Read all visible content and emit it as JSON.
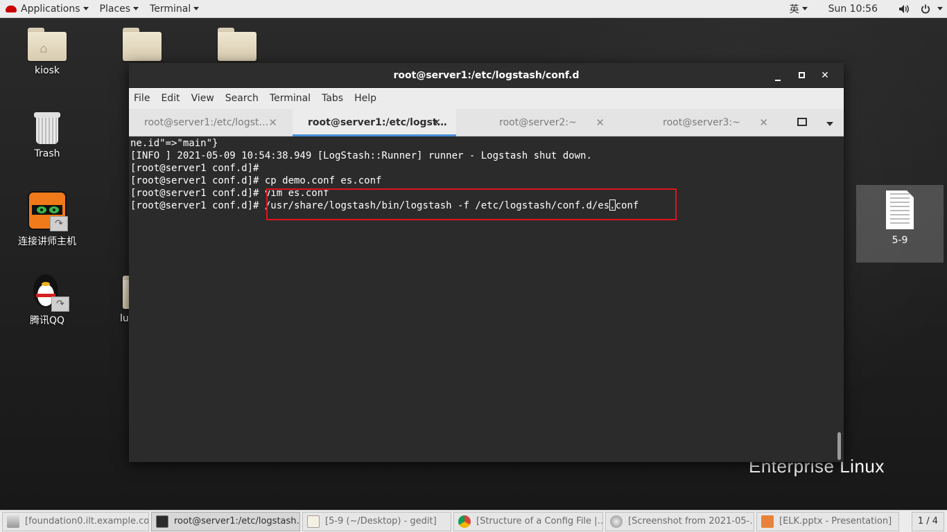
{
  "topbar": {
    "applications": "Applications",
    "places": "Places",
    "terminal": "Terminal",
    "input_method": "英",
    "clock": "Sun 10:56"
  },
  "desktop": {
    "icons": [
      {
        "label": "kiosk",
        "icon": "home-folder-icon"
      },
      {
        "label": "",
        "icon": "folder-icon"
      },
      {
        "label": "",
        "icon": "folder-icon"
      },
      {
        "label": "Trash",
        "icon": "trash-icon"
      },
      {
        "label": "连接讲师主机",
        "icon": "remote-viewer-icon"
      },
      {
        "label": "腾讯QQ",
        "icon": "qq-penguin-icon"
      },
      {
        "label": "lu",
        "icon": "folder-icon"
      }
    ],
    "selected_file": {
      "label": "5-9",
      "icon": "text-document-icon"
    },
    "watermark": "Enterprise Linux"
  },
  "terminal": {
    "title": "root@server1:/etc/logstash/conf.d",
    "menu": [
      "File",
      "Edit",
      "View",
      "Search",
      "Terminal",
      "Tabs",
      "Help"
    ],
    "tabs": [
      {
        "label": "root@server1:/etc/logst…",
        "active": false
      },
      {
        "label": "root@server1:/etc/logst…",
        "active": true
      },
      {
        "label": "root@server2:~",
        "active": false
      },
      {
        "label": "root@server3:~",
        "active": false
      }
    ],
    "lines": [
      "ne.id\"=>\"main\"}",
      "[INFO ] 2021-05-09 10:54:38.949 [LogStash::Runner] runner - Logstash shut down.",
      "[root@server1 conf.d]#",
      "[root@server1 conf.d]# cp demo.conf es.conf",
      "[root@server1 conf.d]# vim es.conf"
    ],
    "last_line_prompt": "[root@server1 conf.d]# ",
    "last_line_before_cursor": "/usr/share/logstash/bin/logstash -f /etc/logstash/conf.d/es",
    "last_line_cursor_char": ".",
    "last_line_after_cursor": "conf",
    "highlight_color": "#e0141a"
  },
  "taskbar": {
    "items": [
      {
        "label": "[foundation0.ilt.example.co…",
        "active": false
      },
      {
        "label": "root@server1:/etc/logstash…",
        "active": true
      },
      {
        "label": "[5-9 (~/Desktop) - gedit]",
        "active": false
      },
      {
        "label": "[Structure of a Config File |…",
        "active": false
      },
      {
        "label": "[Screenshot from 2021-05-…",
        "active": false
      },
      {
        "label": "[ELK.pptx - Presentation]",
        "active": false
      }
    ],
    "pager": "1 / 4"
  }
}
